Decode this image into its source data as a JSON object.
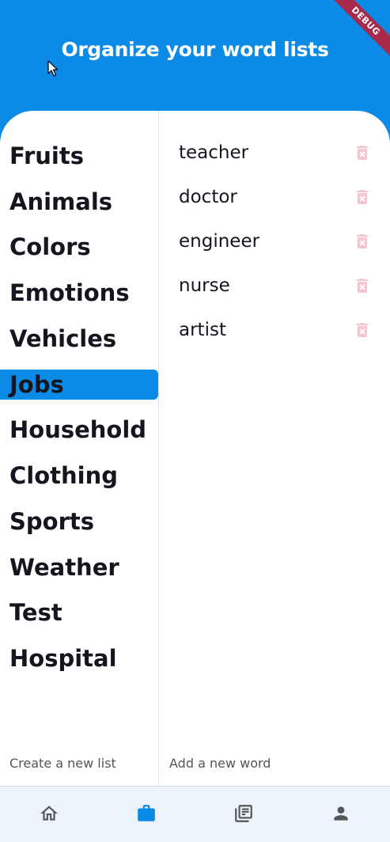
{
  "app_bar": {
    "title": "Organize your word lists",
    "debug_label": "DEBUG"
  },
  "categories": [
    {
      "label": "Fruits",
      "selected": false
    },
    {
      "label": "Animals",
      "selected": false
    },
    {
      "label": "Colors",
      "selected": false
    },
    {
      "label": "Emotions",
      "selected": false
    },
    {
      "label": "Vehicles",
      "selected": false
    },
    {
      "label": "Jobs",
      "selected": true
    },
    {
      "label": "Household",
      "selected": false
    },
    {
      "label": "Clothing",
      "selected": false
    },
    {
      "label": "Sports",
      "selected": false
    },
    {
      "label": "Weather",
      "selected": false
    },
    {
      "label": "Test",
      "selected": false
    },
    {
      "label": "Hospital",
      "selected": false
    }
  ],
  "words": [
    {
      "label": "teacher",
      "delete_icon": "trash-icon"
    },
    {
      "label": "doctor",
      "delete_icon": "trash-icon"
    },
    {
      "label": "engineer",
      "delete_icon": "trash-icon"
    },
    {
      "label": "nurse",
      "delete_icon": "trash-icon"
    },
    {
      "label": "artist",
      "delete_icon": "trash-icon"
    }
  ],
  "footer": {
    "create_list_label": "Create a new list",
    "add_word_label": "Add a new word"
  },
  "bottom_nav": [
    {
      "icon": "home-icon",
      "active": false
    },
    {
      "icon": "briefcase-icon",
      "active": true
    },
    {
      "icon": "library-icon",
      "active": false
    },
    {
      "icon": "person-icon",
      "active": false
    }
  ],
  "colors": {
    "primary": "#0b8ae6",
    "text": "#15151f",
    "delete_icon": "#f5c6d0",
    "nav_inactive": "#555555",
    "nav_background": "#edf3fb"
  }
}
